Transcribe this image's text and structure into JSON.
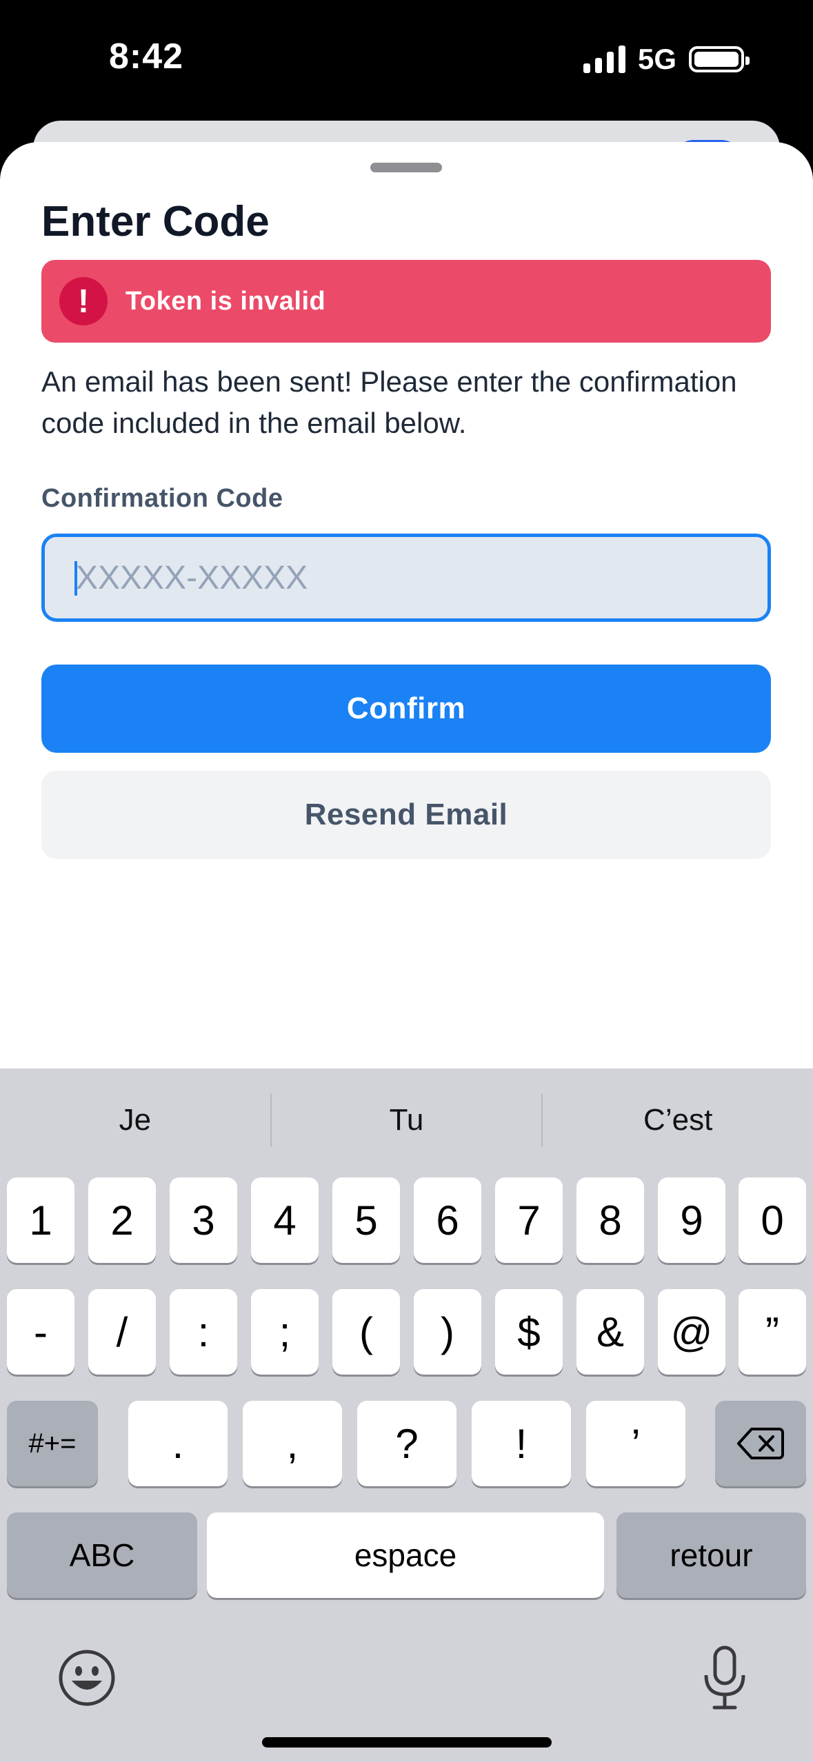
{
  "status_bar": {
    "time": "8:42",
    "network": "5G"
  },
  "modal": {
    "title": "Enter Code",
    "alert": {
      "icon": "!",
      "message": "Token is invalid"
    },
    "description": "An email has been sent! Please enter the confirmation code included in the email below.",
    "field_label": "Confirmation Code",
    "input": {
      "placeholder": "XXXXX-XXXXX",
      "value": ""
    },
    "confirm_label": "Confirm",
    "resend_label": "Resend Email"
  },
  "keyboard": {
    "suggestions": [
      "Je",
      "Tu",
      "C’est"
    ],
    "row1": [
      "1",
      "2",
      "3",
      "4",
      "5",
      "6",
      "7",
      "8",
      "9",
      "0"
    ],
    "row2": [
      "-",
      "/",
      ":",
      ";",
      "(",
      ")",
      "$",
      "&",
      "@",
      "”"
    ],
    "row3_left": "#+=",
    "row3": [
      ".",
      ",",
      "?",
      "!",
      "’"
    ],
    "abc": "ABC",
    "space": "espace",
    "return": "retour"
  },
  "colors": {
    "accent": "#1a82f4",
    "error": "#ec4a69",
    "error_icon": "#d31346"
  }
}
